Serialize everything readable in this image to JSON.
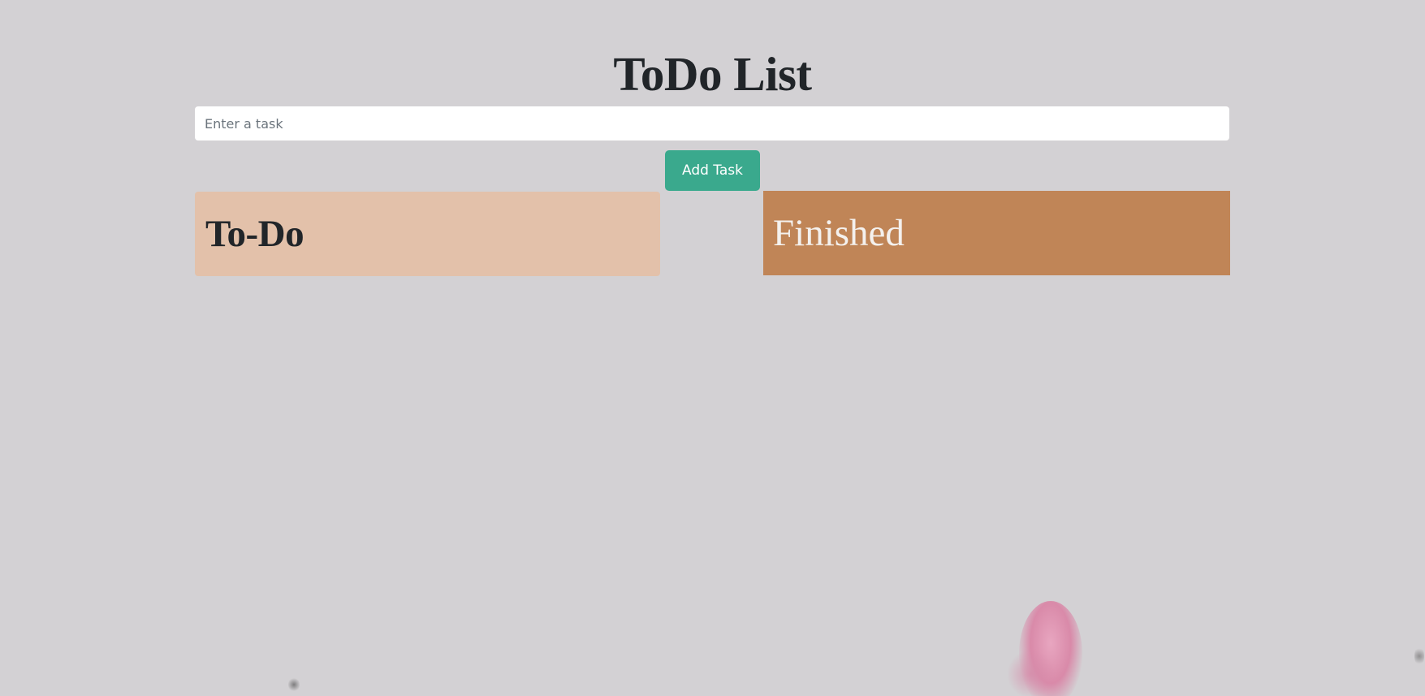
{
  "header": {
    "title": "ToDo List"
  },
  "task_form": {
    "input_value": "",
    "input_placeholder": "Enter a task",
    "add_button_label": "Add Task"
  },
  "columns": {
    "todo": {
      "heading": "To-Do",
      "tasks": []
    },
    "finished": {
      "heading": "Finished",
      "tasks": []
    }
  },
  "colors": {
    "background": "#d3d1d4",
    "accent_button": "#3aa98d",
    "todo_column": "#e3c1aa",
    "finished_column": "#c08557"
  }
}
